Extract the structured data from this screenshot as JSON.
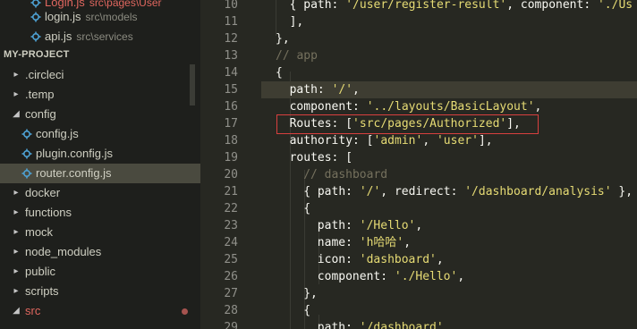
{
  "sidebar": {
    "top_files": [
      {
        "name": "Login.js",
        "path": "src\\pages\\User"
      },
      {
        "name": "login.js",
        "path": "src\\models"
      },
      {
        "name": "api.js",
        "path": "src\\services"
      }
    ],
    "section_title": "MY-PROJECT",
    "tree": [
      {
        "label": ".circleci",
        "twisty": "▸",
        "depth": 0
      },
      {
        "label": ".temp",
        "twisty": "▸",
        "depth": 0
      },
      {
        "label": "config",
        "twisty": "◢",
        "depth": 0
      },
      {
        "label": "config.js",
        "twisty": "",
        "depth": 1,
        "icon": "js-file-icon"
      },
      {
        "label": "plugin.config.js",
        "twisty": "",
        "depth": 1,
        "icon": "js-file-icon"
      },
      {
        "label": "router.config.js",
        "twisty": "",
        "depth": 1,
        "icon": "js-file-icon",
        "selected": true
      },
      {
        "label": "docker",
        "twisty": "▸",
        "depth": 0
      },
      {
        "label": "functions",
        "twisty": "▸",
        "depth": 0
      },
      {
        "label": "mock",
        "twisty": "▸",
        "depth": 0
      },
      {
        "label": "node_modules",
        "twisty": "▸",
        "depth": 0
      },
      {
        "label": "public",
        "twisty": "▸",
        "depth": 0
      },
      {
        "label": "scripts",
        "twisty": "▸",
        "depth": 0
      },
      {
        "label": "src",
        "twisty": "◢",
        "depth": 0,
        "modified": true
      }
    ],
    "colors": {
      "src_label": "#e0675f",
      "js_icon": "#4ea1d3",
      "modified_dot": "#a6534f"
    }
  },
  "editor": {
    "lines": [
      {
        "num": "10",
        "indent": 2,
        "tokens": [
          [
            "p",
            "{ path: "
          ],
          [
            "s",
            "'/user/register-result'"
          ],
          [
            "p",
            ", component: "
          ],
          [
            "s",
            "'./Us"
          ]
        ]
      },
      {
        "num": "11",
        "indent": 2,
        "tokens": [
          [
            "p",
            "],"
          ]
        ]
      },
      {
        "num": "12",
        "indent": 1,
        "tokens": [
          [
            "p",
            "},"
          ]
        ]
      },
      {
        "num": "13",
        "indent": 1,
        "tokens": [
          [
            "c",
            "// app"
          ]
        ]
      },
      {
        "num": "14",
        "indent": 1,
        "tokens": [
          [
            "p",
            "{"
          ]
        ]
      },
      {
        "num": "15",
        "indent": 2,
        "tokens": [
          [
            "p",
            "path: "
          ],
          [
            "s",
            "'/'"
          ],
          [
            "p",
            ","
          ]
        ]
      },
      {
        "num": "16",
        "indent": 2,
        "tokens": [
          [
            "p",
            "component: "
          ],
          [
            "s",
            "'../layouts/BasicLayout'"
          ],
          [
            "p",
            ","
          ]
        ]
      },
      {
        "num": "17",
        "indent": 2,
        "tokens": [
          [
            "p",
            "Routes: ["
          ],
          [
            "s",
            "'src/pages/Authorized'"
          ],
          [
            "p",
            "],"
          ]
        ]
      },
      {
        "num": "18",
        "indent": 2,
        "tokens": [
          [
            "p",
            "authority: ["
          ],
          [
            "s",
            "'admin'"
          ],
          [
            "p",
            ", "
          ],
          [
            "s",
            "'user'"
          ],
          [
            "p",
            "],"
          ]
        ]
      },
      {
        "num": "19",
        "indent": 2,
        "tokens": [
          [
            "p",
            "routes: ["
          ]
        ]
      },
      {
        "num": "20",
        "indent": 3,
        "tokens": [
          [
            "c",
            "// dashboard"
          ]
        ]
      },
      {
        "num": "21",
        "indent": 3,
        "tokens": [
          [
            "p",
            "{ path: "
          ],
          [
            "s",
            "'/'"
          ],
          [
            "p",
            ", redirect: "
          ],
          [
            "s",
            "'/dashboard/analysis'"
          ],
          [
            "p",
            " },"
          ]
        ]
      },
      {
        "num": "22",
        "indent": 3,
        "tokens": [
          [
            "p",
            "{"
          ]
        ]
      },
      {
        "num": "23",
        "indent": 4,
        "tokens": [
          [
            "p",
            "path: "
          ],
          [
            "s",
            "'/Hello'"
          ],
          [
            "p",
            ","
          ]
        ]
      },
      {
        "num": "24",
        "indent": 4,
        "tokens": [
          [
            "p",
            "name: "
          ],
          [
            "s",
            "'h哈哈'"
          ],
          [
            "p",
            ","
          ]
        ]
      },
      {
        "num": "25",
        "indent": 4,
        "tokens": [
          [
            "p",
            "icon: "
          ],
          [
            "s",
            "'dashboard'"
          ],
          [
            "p",
            ","
          ]
        ]
      },
      {
        "num": "26",
        "indent": 4,
        "tokens": [
          [
            "p",
            "component: "
          ],
          [
            "s",
            "'./Hello'"
          ],
          [
            "p",
            ","
          ]
        ]
      },
      {
        "num": "27",
        "indent": 3,
        "tokens": [
          [
            "p",
            "},"
          ]
        ]
      },
      {
        "num": "28",
        "indent": 3,
        "tokens": [
          [
            "p",
            "{"
          ]
        ]
      },
      {
        "num": "29",
        "indent": 4,
        "tokens": [
          [
            "p",
            "path: "
          ],
          [
            "s",
            "'/dashboard'"
          ]
        ]
      }
    ],
    "highlighted_line": "15",
    "boxed_line": "17",
    "colors": {
      "background": "#272822",
      "string": "#e6db74",
      "comment": "#75715e",
      "text": "#f8f8f2",
      "box": "#d8403f"
    }
  }
}
